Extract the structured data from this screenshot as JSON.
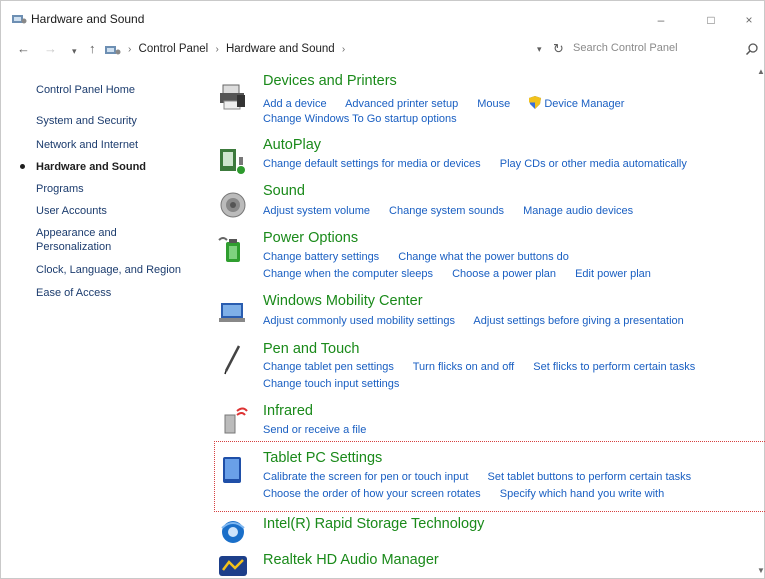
{
  "window": {
    "title": "Hardware and Sound",
    "controls": {
      "minimize": "–",
      "maximize": "□",
      "close": "×"
    }
  },
  "address_bar": {
    "breadcrumbs": [
      "Control Panel",
      "Hardware and Sound"
    ],
    "search_placeholder": "Search Control Panel"
  },
  "sidebar": {
    "items": [
      {
        "label": "Control Panel Home"
      },
      {
        "label": "System and Security"
      },
      {
        "label": "Network and Internet"
      },
      {
        "label": "Hardware and Sound",
        "active": true
      },
      {
        "label": "Programs"
      },
      {
        "label": "User Accounts"
      },
      {
        "label": "Appearance and Personalization"
      },
      {
        "label": "Clock, Language, and Region"
      },
      {
        "label": "Ease of Access"
      }
    ]
  },
  "categories": [
    {
      "title": "Devices and Printers",
      "icon": "printer-icon",
      "links": [
        [
          "Add a device",
          "Advanced printer setup",
          "Mouse",
          "Device Manager"
        ],
        [
          "Change Windows To Go startup options"
        ]
      ]
    },
    {
      "title": "AutoPlay",
      "icon": "autoplay-icon",
      "links": [
        [
          "Change default settings for media or devices",
          "Play CDs or other media automatically"
        ]
      ]
    },
    {
      "title": "Sound",
      "icon": "speaker-icon",
      "links": [
        [
          "Adjust system volume",
          "Change system sounds",
          "Manage audio devices"
        ]
      ]
    },
    {
      "title": "Power Options",
      "icon": "battery-icon",
      "links": [
        [
          "Change battery settings",
          "Change what the power buttons do"
        ],
        [
          "Change when the computer sleeps",
          "Choose a power plan",
          "Edit power plan"
        ]
      ]
    },
    {
      "title": "Windows Mobility Center",
      "icon": "mobility-center-icon",
      "links": [
        [
          "Adjust commonly used mobility settings",
          "Adjust settings before giving a presentation"
        ]
      ]
    },
    {
      "title": "Pen and Touch",
      "icon": "pen-icon",
      "links": [
        [
          "Change tablet pen settings",
          "Turn flicks on and off",
          "Set flicks to perform certain tasks"
        ],
        [
          "Change touch input settings"
        ]
      ]
    },
    {
      "title": "Infrared",
      "icon": "infrared-icon",
      "links": [
        [
          "Send or receive a file"
        ]
      ]
    },
    {
      "title": "Tablet PC Settings",
      "icon": "tablet-icon",
      "links": [
        [
          "Calibrate the screen for pen or touch input",
          "Set tablet buttons to perform certain tasks"
        ],
        [
          "Choose the order of how your screen rotates",
          "Specify which hand you write with"
        ]
      ]
    },
    {
      "title": "Intel(R) Rapid Storage Technology",
      "icon": "intel-storage-icon",
      "links": []
    },
    {
      "title": "Realtek HD Audio Manager",
      "icon": "realtek-audio-icon",
      "links": []
    }
  ],
  "colors": {
    "category_title": "#1a8a1a",
    "link": "#1a5fc2",
    "highlight_border": "#d64040"
  }
}
